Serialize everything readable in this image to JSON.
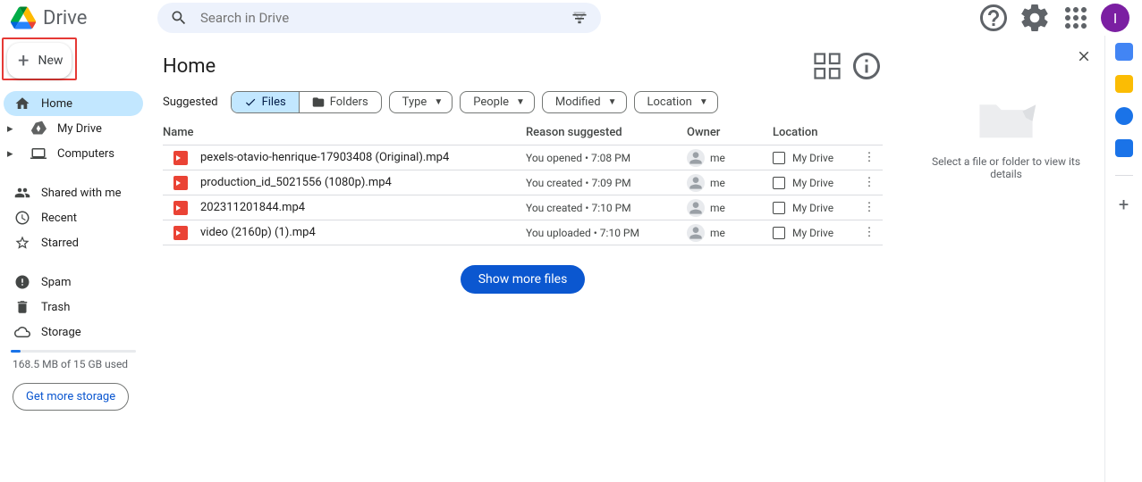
{
  "app": {
    "name": "Drive"
  },
  "search": {
    "placeholder": "Search in Drive"
  },
  "avatar": {
    "initial": "I"
  },
  "sidebar": {
    "new_label": "New",
    "items": [
      {
        "label": "Home",
        "icon": "home-icon",
        "active": true
      },
      {
        "label": "My Drive",
        "icon": "folder-icon",
        "expandable": true
      },
      {
        "label": "Computers",
        "icon": "computer-icon",
        "expandable": true
      }
    ],
    "items2": [
      {
        "label": "Shared with me",
        "icon": "people-icon"
      },
      {
        "label": "Recent",
        "icon": "clock-icon"
      },
      {
        "label": "Starred",
        "icon": "star-icon"
      }
    ],
    "items3": [
      {
        "label": "Spam",
        "icon": "spam-icon"
      },
      {
        "label": "Trash",
        "icon": "trash-icon"
      },
      {
        "label": "Storage",
        "icon": "cloud-icon"
      }
    ],
    "storage_text": "168.5 MB of 15 GB used",
    "storage_btn": "Get more storage"
  },
  "page": {
    "title": "Home",
    "suggested_label": "Suggested",
    "seg_files": "Files",
    "seg_folders": "Folders",
    "filters": [
      "Type",
      "People",
      "Modified",
      "Location"
    ],
    "columns": {
      "name": "Name",
      "reason": "Reason suggested",
      "owner": "Owner",
      "location": "Location"
    },
    "show_more": "Show more files"
  },
  "files": [
    {
      "name": "pexels-otavio-henrique-17903408 (Original).mp4",
      "reason": "You opened • 7:08 PM",
      "owner": "me",
      "location": "My Drive"
    },
    {
      "name": "production_id_5021556 (1080p).mp4",
      "reason": "You created • 7:09 PM",
      "owner": "me",
      "location": "My Drive"
    },
    {
      "name": "202311201844.mp4",
      "reason": "You created • 7:10 PM",
      "owner": "me",
      "location": "My Drive"
    },
    {
      "name": "video (2160p) (1).mp4",
      "reason": "You uploaded • 7:10 PM",
      "owner": "me",
      "location": "My Drive"
    }
  ],
  "details": {
    "empty_text": "Select a file or folder to view its details"
  }
}
